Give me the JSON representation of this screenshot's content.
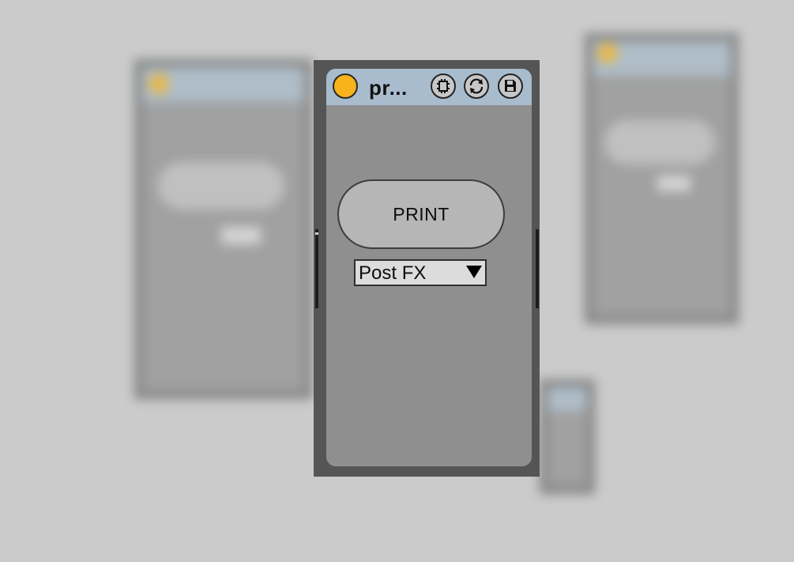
{
  "device": {
    "name": "pr...",
    "power_on": true,
    "colors": {
      "title_bar": "#a8bcce",
      "power": "#f7b21c",
      "body": "#8f8f8f",
      "frame": "#555555"
    },
    "title_icons": [
      "freeze-icon",
      "reload-icon",
      "save-icon"
    ]
  },
  "controls": {
    "print_label": "PRINT",
    "menu_value": "Post FX"
  }
}
